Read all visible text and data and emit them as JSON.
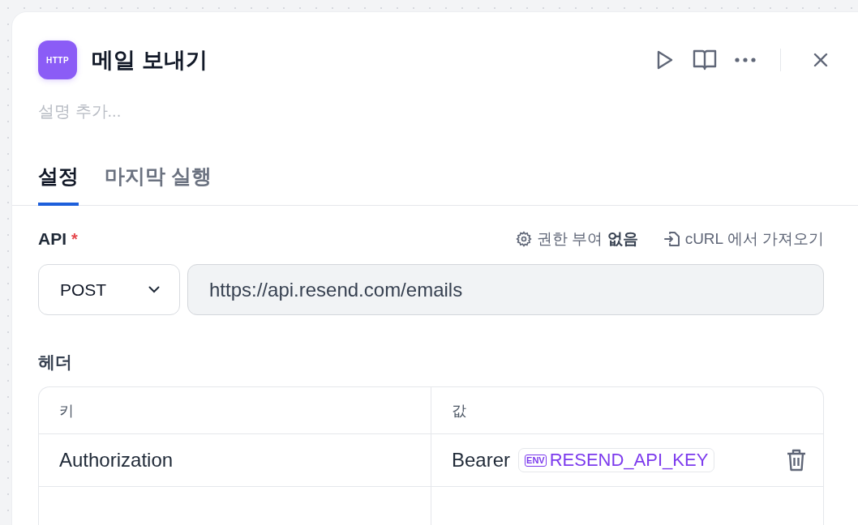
{
  "node": {
    "icon_label": "HTTP",
    "title": "메일 보내기",
    "description_placeholder": "설명 추가..."
  },
  "tabs": [
    {
      "label": "설정",
      "selected": true
    },
    {
      "label": "마지막 실행",
      "selected": false
    }
  ],
  "api": {
    "label": "API",
    "required_mark": "*",
    "auth_link": "권한 부여 **없음**",
    "import_link": "cURL 에서 가져오기",
    "method": "POST",
    "url": "https://api.resend.com/emails"
  },
  "headers": {
    "label": "헤더",
    "columns": [
      "키",
      "값"
    ],
    "rows": [
      {
        "key": "Authorization",
        "value_prefix": "Bearer",
        "env_badge": "ENV",
        "env_var": "RESEND_API_KEY"
      }
    ]
  }
}
